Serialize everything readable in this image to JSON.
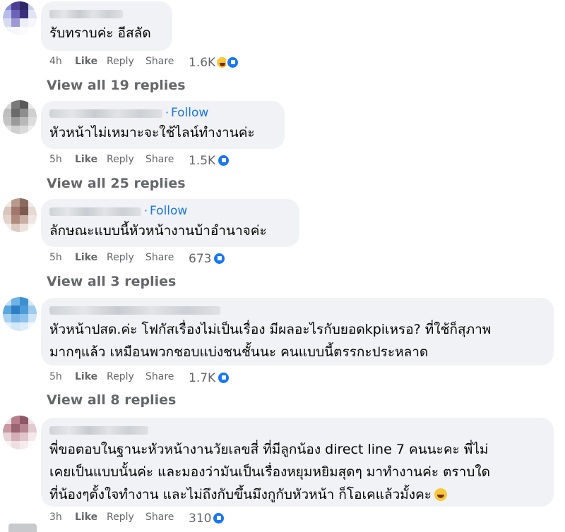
{
  "comments": [
    {
      "text_lines": [
        "รับทราบค่ะ อีสลัด"
      ],
      "time": "4h",
      "like_label": "Like",
      "reply_label": "Reply",
      "share_label": "Share",
      "reaction_count": "1.6K",
      "reaction_icons": [
        "haha-icon",
        "like-icon"
      ],
      "view_replies": "View all 19 replies",
      "follow": ""
    },
    {
      "text_lines": [
        "หัวหน้าไม่เหมาะจะใช้ไลน์ทำงานค่ะ"
      ],
      "time": "5h",
      "like_label": "Like",
      "reply_label": "Reply",
      "share_label": "Share",
      "reaction_count": "1.5K",
      "reaction_icons": [
        "like-icon"
      ],
      "view_replies": "View all 25 replies",
      "follow": "Follow"
    },
    {
      "text_lines": [
        "ลักษณะแบบนี้หัวหน้างานบ้าอำนาจค่ะ"
      ],
      "time": "5h",
      "like_label": "Like",
      "reply_label": "Reply",
      "share_label": "Share",
      "reaction_count": "673",
      "reaction_icons": [
        "like-icon"
      ],
      "view_replies": "View all 3 replies",
      "follow": "Follow"
    },
    {
      "text_lines": [
        "หัวหน้าปสด.ค่ะ โฟกัสเรื่องไม่เป็นเรื่อง มีผลอะไรกับยอดkpiเหรอ? ที่ใช้ก็สุภาพ",
        "มากๆแล้ว เหมือนพวกชอบแบ่งชนชั้นนะ คนแบบนี้ตรรกะประหลาด"
      ],
      "time": "5h",
      "like_label": "Like",
      "reply_label": "Reply",
      "share_label": "Share",
      "reaction_count": "1.7K",
      "reaction_icons": [
        "like-icon"
      ],
      "view_replies": "View all 8 replies",
      "follow": ""
    },
    {
      "text_lines": [
        "พี่ขอตอบในฐานะหัวหน้างานวัยเลขสี่ ที่มีลูกน้อง direct line 7 คนนะคะ พี่ไม่",
        "เคยเป็นแบบนั้นค่ะ และมองว่ามันเป็นเรื่องหยุมหยิมสุดๆ มาทำงานค่ะ ตราบใด",
        "ที่น้องๆตั้งใจทำงาน และไม่ถึงกับขึ้นมึงกูกับหัวหน้า ก็โอเคแล้วมั้งคะ"
      ],
      "time": "3h",
      "like_label": "Like",
      "reply_label": "Reply",
      "share_label": "Share",
      "reaction_count": "310",
      "reaction_icons": [
        "like-icon"
      ],
      "view_replies": "",
      "follow": "",
      "trailing_emoji": "laughing-tears-emoji"
    }
  ],
  "colors": {
    "bubble": "#f0f2f5",
    "follow": "#1b74e4",
    "meta": "#65676b",
    "like": "#1877f2"
  }
}
